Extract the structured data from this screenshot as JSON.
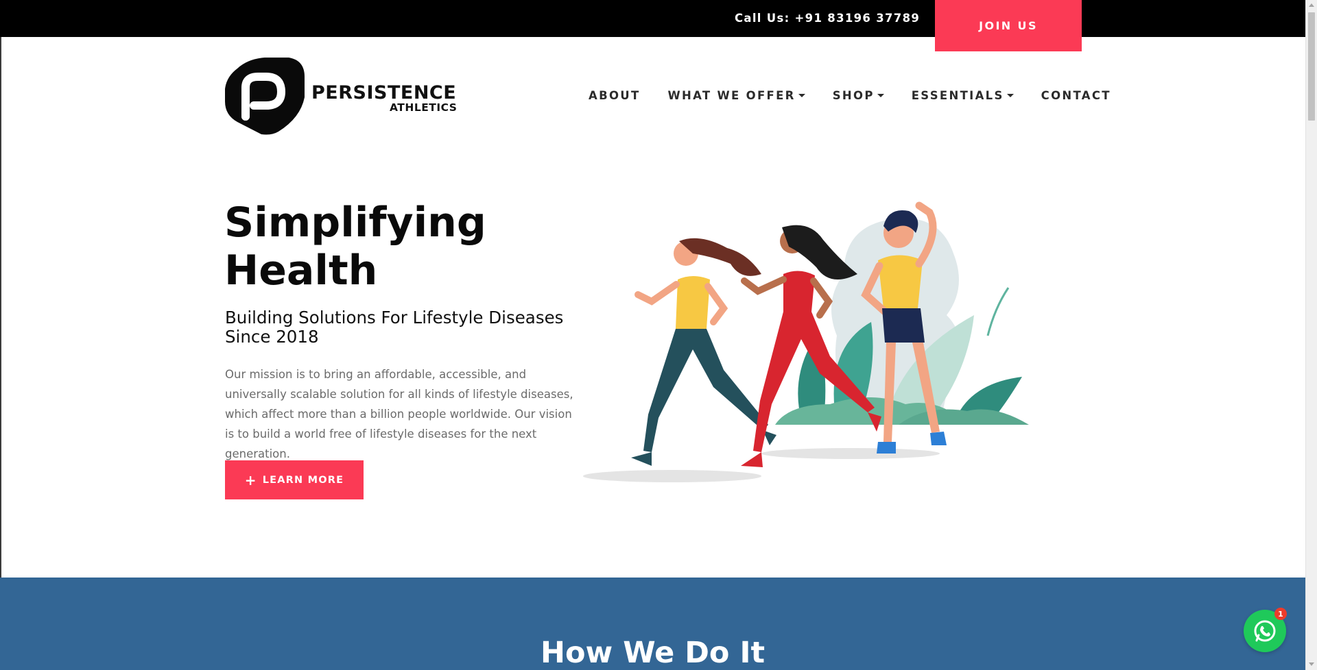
{
  "topbar": {
    "call_label": "Call Us: +91 83196 37789",
    "join_label": "JOIN US"
  },
  "brand": {
    "name": "PERSISTENCE",
    "tagline": "ATHLETICS"
  },
  "nav": {
    "items": [
      {
        "label": "ABOUT",
        "dropdown": false
      },
      {
        "label": "WHAT WE OFFER",
        "dropdown": true
      },
      {
        "label": "SHOP",
        "dropdown": true
      },
      {
        "label": "ESSENTIALS",
        "dropdown": true
      },
      {
        "label": "CONTACT",
        "dropdown": false
      }
    ]
  },
  "hero": {
    "title_line1": "Simplifying",
    "title_line2": "Health",
    "subtitle": "Building Solutions For Lifestyle Diseases Since 2018",
    "body": "Our mission is to bring an affordable, accessible, and universally scalable solution for all kinds of lifestyle diseases, which affect more than a billion people worldwide. Our vision is to build a world free of lifestyle diseases for the next generation.",
    "cta_label": "LEARN MORE"
  },
  "section": {
    "heading": "How We Do It"
  },
  "whatsapp": {
    "badge_count": "1"
  },
  "colors": {
    "accent": "#fb3a55",
    "blue_section": "#336695",
    "whatsapp": "#1fc95a"
  }
}
